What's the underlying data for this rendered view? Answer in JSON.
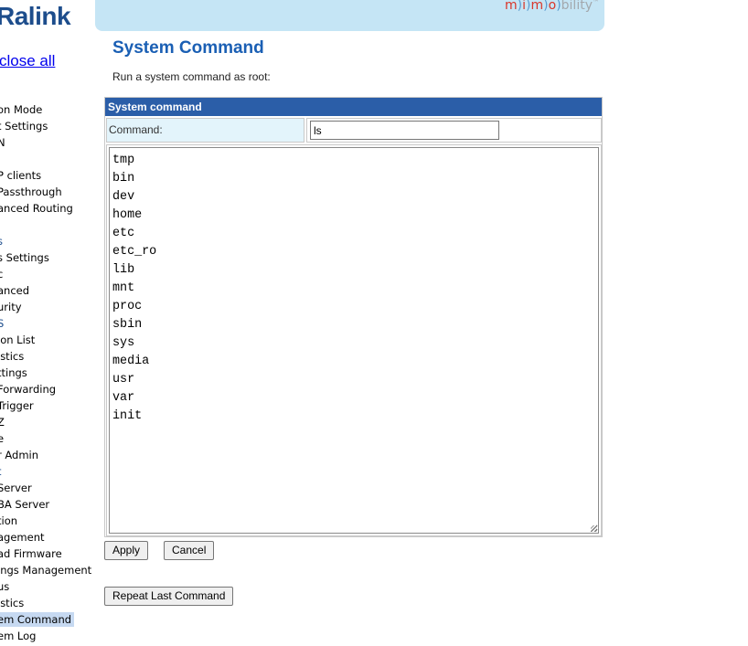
{
  "sidebar": {
    "logo": "Ralink",
    "close_all": "close all",
    "items": [
      {
        "label": "on Mode"
      },
      {
        "label": "t Settings"
      },
      {
        "label": "N"
      },
      {
        "label": "P clients"
      },
      {
        "label": " Passthrough"
      },
      {
        "label": "anced Routing"
      },
      {
        "label": "s"
      },
      {
        "label": "s Settings"
      },
      {
        "label": "c"
      },
      {
        "label": "anced"
      },
      {
        "label": "urity"
      },
      {
        "label": "S"
      },
      {
        "label": "ion List"
      },
      {
        "label": "istics"
      },
      {
        "label": "ttings"
      },
      {
        "label": " Forwarding"
      },
      {
        "label": " Trigger"
      },
      {
        "label": "Z"
      },
      {
        "label": "e"
      },
      {
        "label": "r Admin"
      },
      {
        "label": "t"
      },
      {
        "label": " Server"
      },
      {
        "label": "BA Server"
      },
      {
        "label": "tion"
      },
      {
        "label": "agement"
      },
      {
        "label": "ad Firmware"
      },
      {
        "label": "ings Management"
      },
      {
        "label": "us"
      },
      {
        "label": "istics"
      },
      {
        "label": "em Command"
      },
      {
        "label": "em Log"
      }
    ]
  },
  "header": {
    "brand": {
      "m1": "m",
      "i": "i",
      "m2": "m",
      "o": "o",
      "rest": "bility"
    }
  },
  "main": {
    "title": "System Command",
    "intro": "Run a system command as root:",
    "table_header": "System command",
    "command_label": "Command:",
    "command_value": "ls",
    "output_lines": [
      "tmp",
      "bin",
      "dev",
      "home",
      "etc",
      "etc_ro",
      "lib",
      "mnt",
      "proc",
      "sbin",
      "sys",
      "media",
      "usr",
      "var",
      "init"
    ],
    "apply_label": "Apply",
    "cancel_label": "Cancel",
    "repeat_label": "Repeat Last Command"
  },
  "colors": {
    "title": "#1a5fb4",
    "table_header_bg": "#2b5ea8",
    "label_cell_bg": "#e3f4fb",
    "banner_bg": "#c5e5f5",
    "active_menu_bg": "#c6d9f1"
  }
}
